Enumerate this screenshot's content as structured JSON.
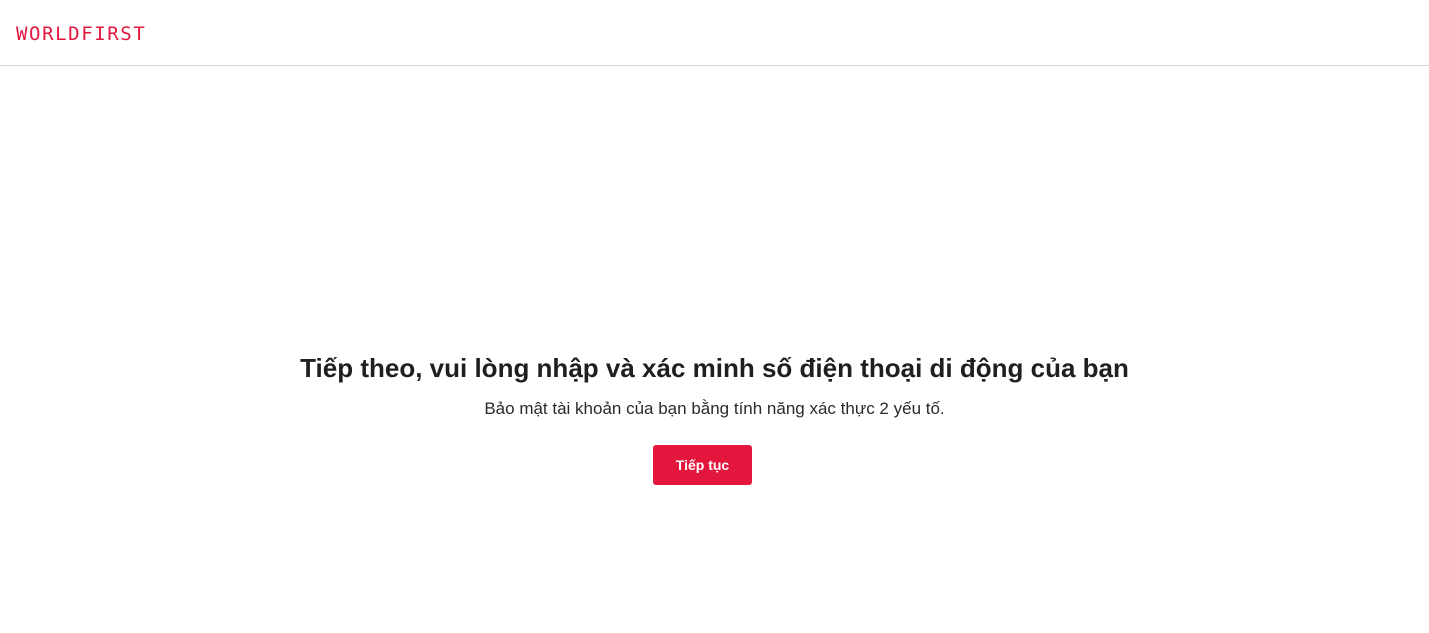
{
  "header": {
    "logo_text": "WORLDFIRST"
  },
  "main": {
    "title": "Tiếp theo, vui lòng nhập và xác minh số điện thoại di động của bạn",
    "subtitle": "Bảo mật tài khoản của bạn bằng tính năng xác thực 2 yếu tố.",
    "continue_label": "Tiếp tục"
  },
  "colors": {
    "brand": "#e3173e",
    "divider": "#d4d4d4",
    "text": "#1f1f1f"
  }
}
